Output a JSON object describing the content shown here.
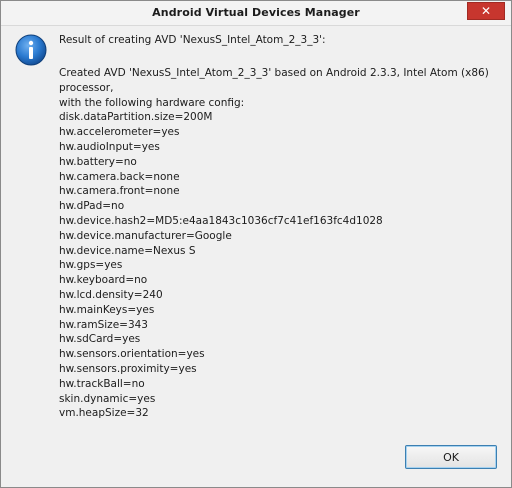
{
  "window": {
    "title": "Android Virtual Devices Manager",
    "close_label": "✕"
  },
  "dialog": {
    "icon": "info-icon",
    "result_line": "Result of creating AVD 'NexusS_Intel_Atom_2_3_3':",
    "lines": [
      "Created AVD 'NexusS_Intel_Atom_2_3_3' based on Android 2.3.3, Intel Atom (x86)",
      "processor,",
      "with the following hardware config:",
      "disk.dataPartition.size=200M",
      "hw.accelerometer=yes",
      "hw.audioInput=yes",
      "hw.battery=no",
      "hw.camera.back=none",
      "hw.camera.front=none",
      "hw.dPad=no",
      "hw.device.hash2=MD5:e4aa1843c1036cf7c41ef163fc4d1028",
      "hw.device.manufacturer=Google",
      "hw.device.name=Nexus S",
      "hw.gps=yes",
      "hw.keyboard=no",
      "hw.lcd.density=240",
      "hw.mainKeys=yes",
      "hw.ramSize=343",
      "hw.sdCard=yes",
      "hw.sensors.orientation=yes",
      "hw.sensors.proximity=yes",
      "hw.trackBall=no",
      "skin.dynamic=yes",
      "vm.heapSize=32"
    ],
    "ok_label": "OK"
  },
  "colors": {
    "close_button": "#c7362e",
    "info_icon": "#1e6fc2",
    "ok_border": "#3c7fb1"
  }
}
